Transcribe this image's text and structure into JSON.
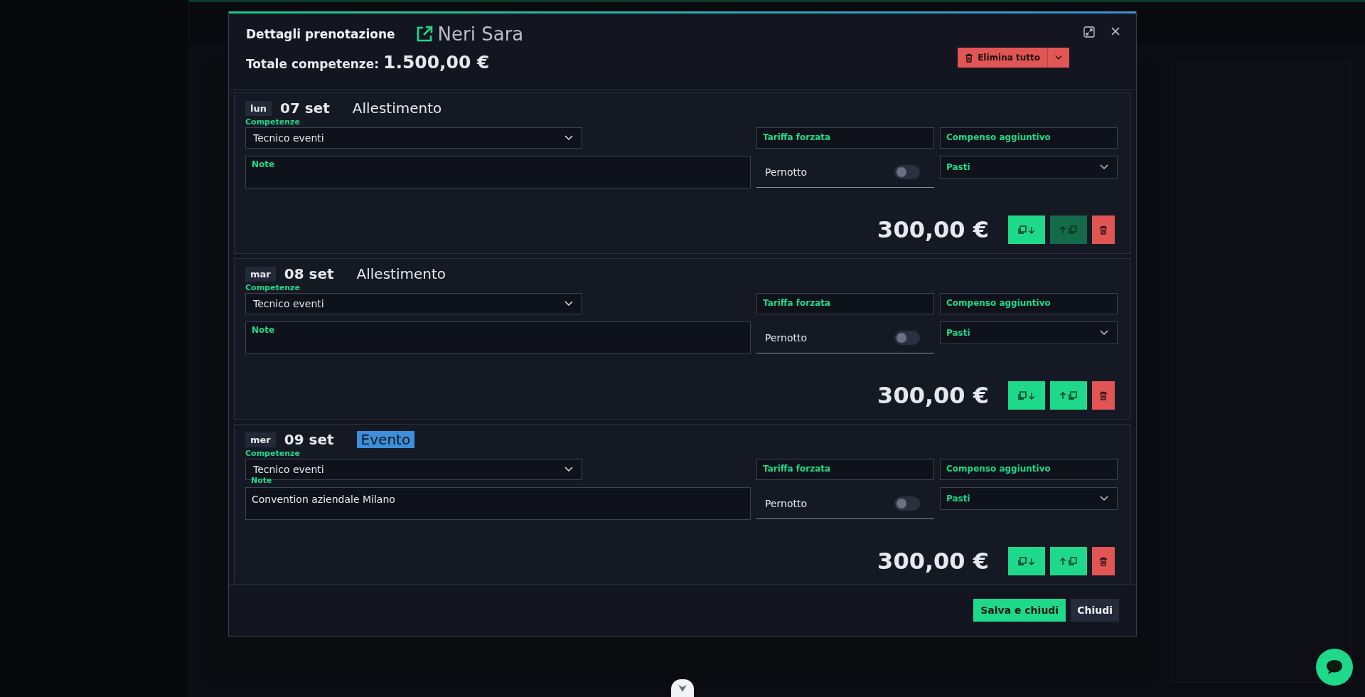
{
  "header": {
    "title": "Dettagli prenotazione",
    "person": "Neri Sara",
    "total_label": "Totale competenze:",
    "total": "1.500,00 €",
    "delete_all": "Elimina tutto"
  },
  "days": [
    {
      "weekday": "lun",
      "date": "07 set",
      "phase": "Allestimento",
      "phase_highlighted": false,
      "competence_label": "Competenze",
      "competence": "Tecnico eventi",
      "forced_rate_label": "Tariffa forzata",
      "extra_label": "Compenso aggiuntivo",
      "notes_label": "Note",
      "overnight_label": "Pernotto",
      "overnight": false,
      "meals_label": "Pasti",
      "amount": "300,00 €",
      "copy_up_disabled": true
    },
    {
      "weekday": "mar",
      "date": "08 set",
      "phase": "Allestimento",
      "phase_highlighted": false,
      "competence_label": "Competenze",
      "competence": "Tecnico eventi",
      "forced_rate_label": "Tariffa forzata",
      "extra_label": "Compenso aggiuntivo",
      "notes_label": "Note",
      "overnight_label": "Pernotto",
      "overnight": false,
      "meals_label": "Pasti",
      "amount": "300,00 €",
      "copy_up_disabled": false
    },
    {
      "weekday": "mer",
      "date": "09 set",
      "phase": "Evento",
      "phase_highlighted": true,
      "competence_label": "Competenze",
      "competence": "Tecnico eventi",
      "forced_rate_label": "Tariffa forzata",
      "extra_label": "Compenso aggiuntivo",
      "notes_label": "Note",
      "notes": "Convention aziendale Milano",
      "overnight_label": "Pernotto",
      "overnight": false,
      "meals_label": "Pasti",
      "amount": "300,00 €",
      "copy_up_disabled": false
    }
  ],
  "footer": {
    "save": "Salva e chiudi",
    "close": "Chiudi"
  }
}
